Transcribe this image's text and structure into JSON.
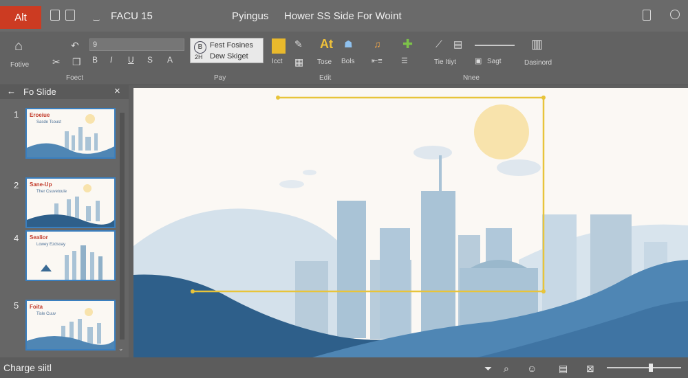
{
  "titlebar": {
    "alt_label": "Alt",
    "file_name": "FACU 15",
    "menu_text": "Pyingus",
    "title": "Hower SS Side For Woint"
  },
  "ribbon": {
    "left_button_label": "Fotive",
    "font_box_value": "9",
    "style_line1": "Fest Fosines",
    "style_line2": "Dew Skiget",
    "style_icon_top": "B",
    "style_icon_bottom": "2H",
    "btn_bold_label": "Icct",
    "btn_ai_label": "Tose",
    "btn_bool_label": "Bols",
    "btn_text_glyph": "At",
    "btn_tie_label": "Tie Itiyt",
    "btn_sagt_label": "Sagt",
    "btn_dashboard_label": "Dasinord",
    "group_font": "Foect",
    "group_pay": "Pay",
    "group_edit": "Edit",
    "group_nnee": "Nnee"
  },
  "panel": {
    "back_icon": "arrow-left-icon",
    "title": "Fo Slide",
    "close_glyph": "×",
    "slides": [
      {
        "num": "1",
        "title": "Eroeiue",
        "subtitle": "Sasde Tsoust"
      },
      {
        "num": "2",
        "title": "Sane-Up",
        "subtitle": "Ther Csuvetoule"
      },
      {
        "num": "4",
        "title": "Sealior",
        "subtitle": "Lowey Ezdsoay"
      },
      {
        "num": "5",
        "title": "Foita",
        "subtitle": "Tisle Cuuv"
      }
    ]
  },
  "status": {
    "text": "Charge siitl"
  },
  "zoom": {
    "level": 0.6
  },
  "colors": {
    "accent_red": "#cc3b22",
    "selection_yellow": "#e8c43a",
    "sun": "#f8e3ac",
    "sky": "#fbf8f4",
    "hill_dark": "#2e5f8a",
    "hill_mid": "#4f86b4",
    "building": "#a9c3d6"
  }
}
